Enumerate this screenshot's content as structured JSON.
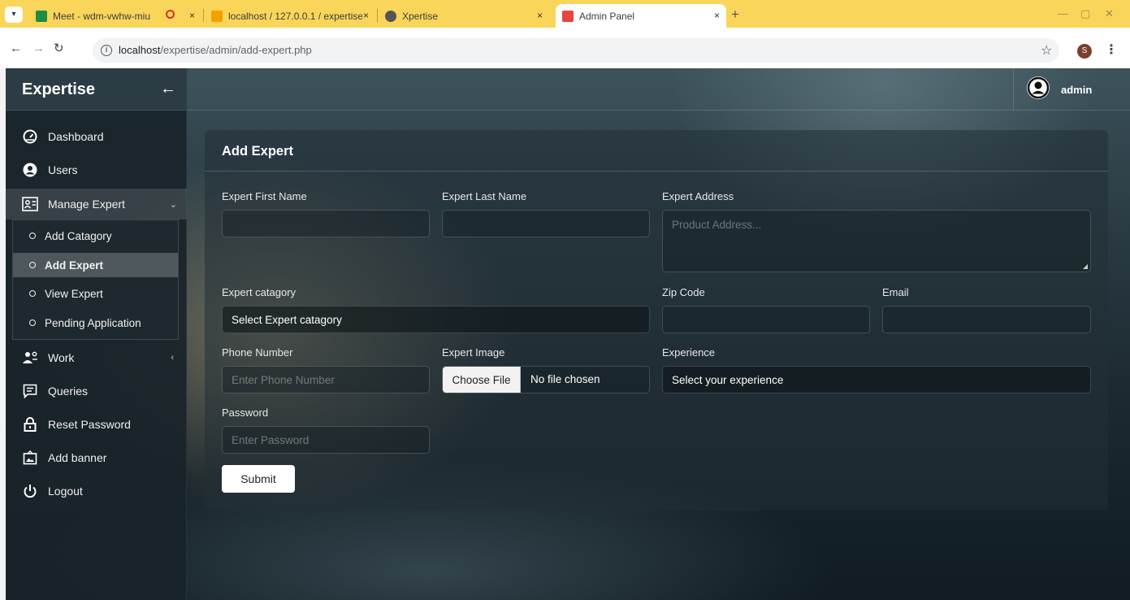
{
  "browser": {
    "tabs": [
      {
        "title": "Meet - wdm-vwhw-miu",
        "active": false
      },
      {
        "title": "localhost / 127.0.0.1 / expertise",
        "active": false
      },
      {
        "title": "Xpertise",
        "active": false
      },
      {
        "title": "Admin Panel",
        "active": true
      }
    ],
    "close_glyph": "×",
    "new_tab_glyph": "+",
    "url_host": "localhost",
    "url_path": "/expertise/admin/add-expert.php",
    "profile_initial": "S"
  },
  "sidebar": {
    "brand": "Expertise",
    "items": [
      {
        "label": "Dashboard",
        "icon": "dashboard-icon"
      },
      {
        "label": "Users",
        "icon": "user-icon"
      },
      {
        "label": "Manage Expert",
        "icon": "manage-expert-icon"
      },
      {
        "label": "Work",
        "icon": "work-icon"
      },
      {
        "label": "Queries",
        "icon": "queries-icon"
      },
      {
        "label": "Reset Password",
        "icon": "lock-icon"
      },
      {
        "label": "Add banner",
        "icon": "banner-icon"
      },
      {
        "label": "Logout",
        "icon": "power-icon"
      }
    ],
    "submenu": [
      {
        "label": "Add Catagory"
      },
      {
        "label": "Add Expert",
        "active": true
      },
      {
        "label": "View Expert"
      },
      {
        "label": "Pending Application"
      }
    ]
  },
  "topbar": {
    "username": "admin"
  },
  "form": {
    "title": "Add Expert",
    "first_name_label": "Expert First Name",
    "last_name_label": "Expert Last Name",
    "address_label": "Expert Address",
    "address_placeholder": "Product Address...",
    "category_label": "Expert catagory",
    "category_value": "Select Expert catagory",
    "zip_label": "Zip Code",
    "email_label": "Email",
    "phone_label": "Phone Number",
    "phone_placeholder": "Enter Phone Number",
    "image_label": "Expert Image",
    "file_button": "Choose File",
    "file_status": "No file chosen",
    "experience_label": "Experience",
    "experience_value": "Select your experience",
    "password_label": "Password",
    "password_placeholder": "Enter Password",
    "submit_label": "Submit"
  },
  "colors": {
    "tab_strip": "#f9d65a",
    "sidebar_bg": "#19242a",
    "active_submenu": "#5a666c"
  }
}
